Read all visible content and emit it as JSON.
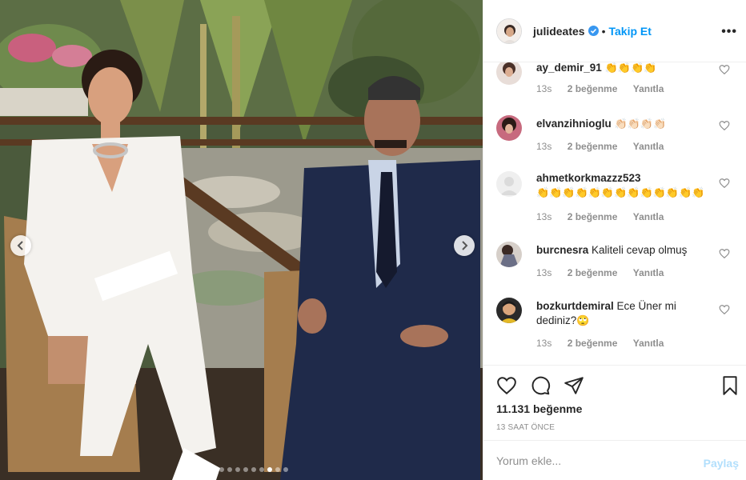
{
  "post": {
    "username": "julideates",
    "follow_label": "Takip Et",
    "separator": "•",
    "more_label": "•••",
    "likes_text": "11.131 beğenme",
    "time_ago": "13 SAAT ÖNCE",
    "carousel": {
      "count": 11,
      "active_index": 8
    }
  },
  "comments": [
    {
      "username": "ay_demir_91",
      "text": "",
      "emoji": "👏👏👏👏",
      "time": "13s",
      "likes": "2 beğenme",
      "reply": "Yanıtla"
    },
    {
      "username": "elvanzihnioglu",
      "text": "",
      "emoji": "👏🏻👏🏻👏🏻👏🏻",
      "time": "13s",
      "likes": "2 beğenme",
      "reply": "Yanıtla"
    },
    {
      "username": "ahmetkorkmazzz523",
      "text": "",
      "emoji": "👏👏👏👏👏👏👏👏👏👏👏👏👏",
      "time": "13s",
      "likes": "2 beğenme",
      "reply": "Yanıtla"
    },
    {
      "username": "burcnesra",
      "text": "Kaliteli cevap olmuş",
      "emoji": "",
      "time": "13s",
      "likes": "2 beğenme",
      "reply": "Yanıtla"
    },
    {
      "username": "bozkurtdemiral",
      "text": "Ece Üner mi dediniz?",
      "emoji": "🙄",
      "time": "13s",
      "likes": "2 beğenme",
      "reply": "Yanıtla"
    }
  ],
  "comment_box": {
    "placeholder": "Yorum ekle...",
    "share_label": "Paylaş"
  },
  "colors": {
    "accent": "#0095f6",
    "share_disabled": "#b2dffc",
    "meta": "#8e8e8e"
  },
  "icons": [
    "verified-badge-icon",
    "more-options-icon",
    "heart-icon",
    "comment-icon",
    "share-icon",
    "bookmark-icon",
    "chevron-left-icon",
    "chevron-right-icon"
  ]
}
